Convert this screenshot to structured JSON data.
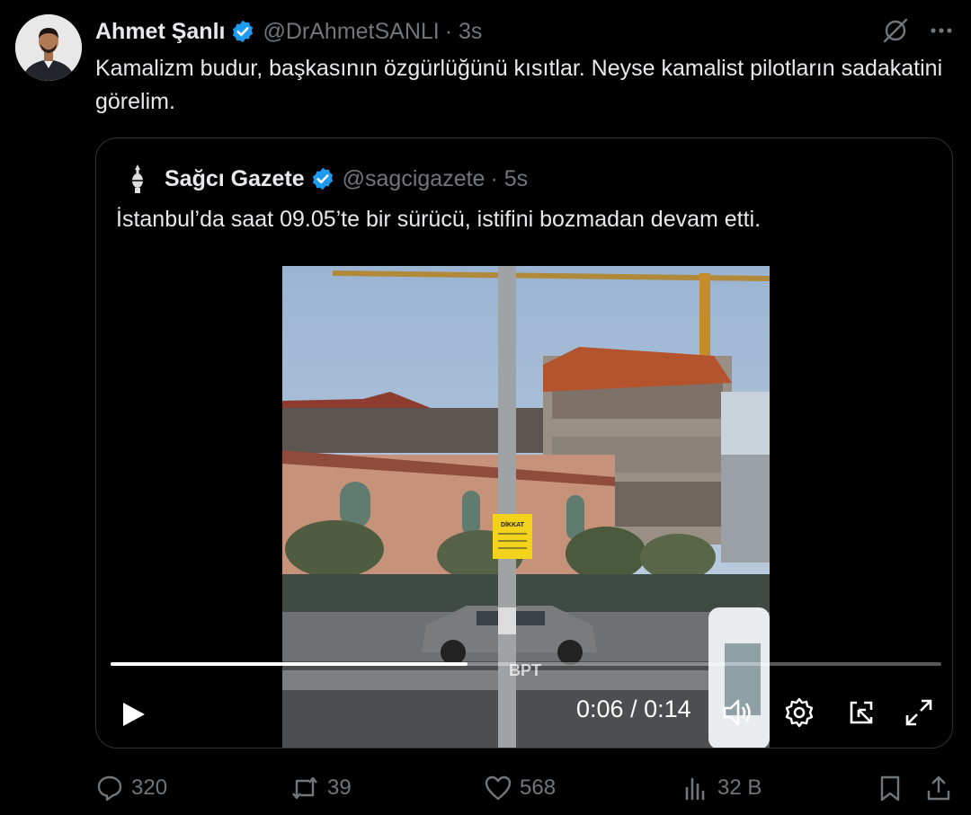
{
  "author": {
    "name": "Ahmet Şanlı",
    "handle": "@DrAhmetSANLI",
    "time": "· 3s",
    "verified_color": "#1d9bf0"
  },
  "tweet_text": "Kamalizm budur, başkasının özgürlüğünü kısıtlar. Neyse kamalist pilotların sadakatini görelim.",
  "quoted": {
    "name": "Sağcı Gazete",
    "handle": "@sagcigazete",
    "time": "· 5s",
    "text": "İstanbul’da saat 09.05’te bir sürücü, istifini bozmadan devam etti."
  },
  "video": {
    "current_time": "0:06",
    "separator": "/",
    "duration": "0:14",
    "progress_fraction": 0.43,
    "sign_text": "DİKKAT",
    "watermark": "BPT"
  },
  "actions": {
    "replies": "320",
    "reposts": "39",
    "likes": "568",
    "views": "32 B"
  },
  "icons": {
    "grok": "grok-icon",
    "more": "more-icon",
    "reply": "reply-icon",
    "repost": "repost-icon",
    "like": "heart-icon",
    "views": "views-icon",
    "bookmark": "bookmark-icon",
    "share": "share-icon"
  }
}
